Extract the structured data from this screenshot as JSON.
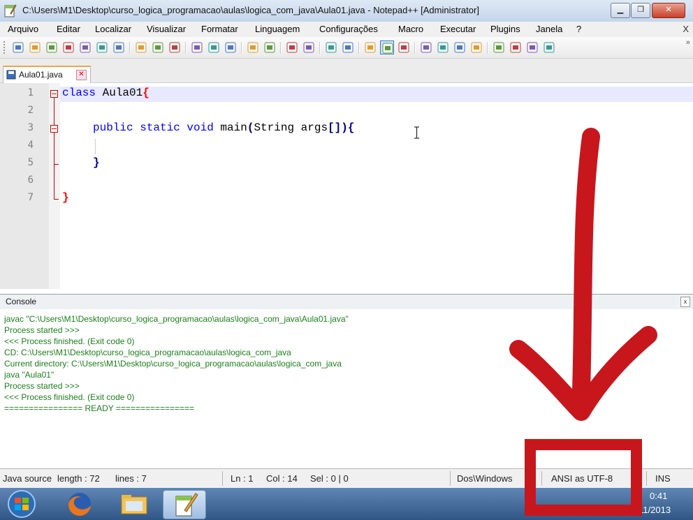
{
  "window": {
    "title": "C:\\Users\\M1\\Desktop\\curso_logica_programacao\\aulas\\logica_com_java\\Aula01.java - Notepad++ [Administrator]",
    "menu_close": "X"
  },
  "menu": [
    "Arquivo",
    "Editar",
    "Localizar",
    "Visualizar",
    "Formatar",
    "Linguagem",
    "Configurações",
    "Macro",
    "Executar",
    "Plugins",
    "Janela",
    "?"
  ],
  "toolbar": {
    "more": "»",
    "icons": [
      "new-file-icon",
      "open-folder-icon",
      "save-icon",
      "save-all-icon",
      "close-file-icon",
      "close-all-icon",
      "print-icon",
      "cut-icon",
      "copy-icon",
      "paste-icon",
      "undo-icon",
      "redo-icon",
      "find-icon",
      "replace-icon",
      "zoom-in-icon",
      "zoom-out-icon",
      "sync-vertical-icon",
      "sync-horizontal-icon",
      "word-wrap-icon",
      "show-all-chars-icon",
      "indent-guide-icon",
      "user-lang-icon",
      "doc-map-icon",
      "function-list-icon",
      "record-macro-icon",
      "stop-record-icon",
      "play-macro-icon",
      "run-multiple-icon",
      "save-macro-icon",
      "spell-check-icon"
    ]
  },
  "tabs": [
    {
      "label": "Aula01.java"
    }
  ],
  "editor": {
    "line_numbers": [
      "1",
      "2",
      "3",
      "4",
      "5",
      "6",
      "7"
    ],
    "code": {
      "l1_kw": "class",
      "l1_name": " Aula01",
      "l1_brace": "{",
      "l3_mods": "public static void",
      "l3_sig": " main",
      "l3_paren_open": "(",
      "l3_params": "String args",
      "l3_brackets": "[]",
      "l3_paren_close": ")",
      "l3_brace": "{",
      "l5_brace": "}",
      "l7_brace": "}"
    }
  },
  "console": {
    "title": "Console",
    "close": "x",
    "lines": [
      "javac \"C:\\Users\\M1\\Desktop\\curso_logica_programacao\\aulas\\logica_com_java\\Aula01.java\"",
      "Process started >>>",
      "<<< Process finished. (Exit code 0)",
      "CD: C:\\Users\\M1\\Desktop\\curso_logica_programacao\\aulas\\logica_com_java",
      "Current directory: C:\\Users\\M1\\Desktop\\curso_logica_programacao\\aulas\\logica_com_java",
      "java \"Aula01\"",
      "Process started >>>",
      "<<< Process finished. (Exit code 0)",
      "================ READY ================"
    ]
  },
  "statusbar": {
    "lang": "Java source",
    "length": "length : 72",
    "lines": "lines : 7",
    "ln": "Ln : 1",
    "col": "Col : 14",
    "sel": "Sel : 0 | 0",
    "eol": "Dos\\Windows",
    "encoding": "ANSI as UTF-8",
    "mode": "INS"
  },
  "taskbar": {
    "time": "0:41",
    "date": "26/11/2013",
    "apps": [
      "firefox-icon",
      "explorer-icon",
      "notepadpp-icon"
    ]
  },
  "colors": {
    "keyword": "#0000ff",
    "brace": "#ff0000",
    "console_text": "#1a7f1a",
    "annotation": "#c8161d"
  }
}
